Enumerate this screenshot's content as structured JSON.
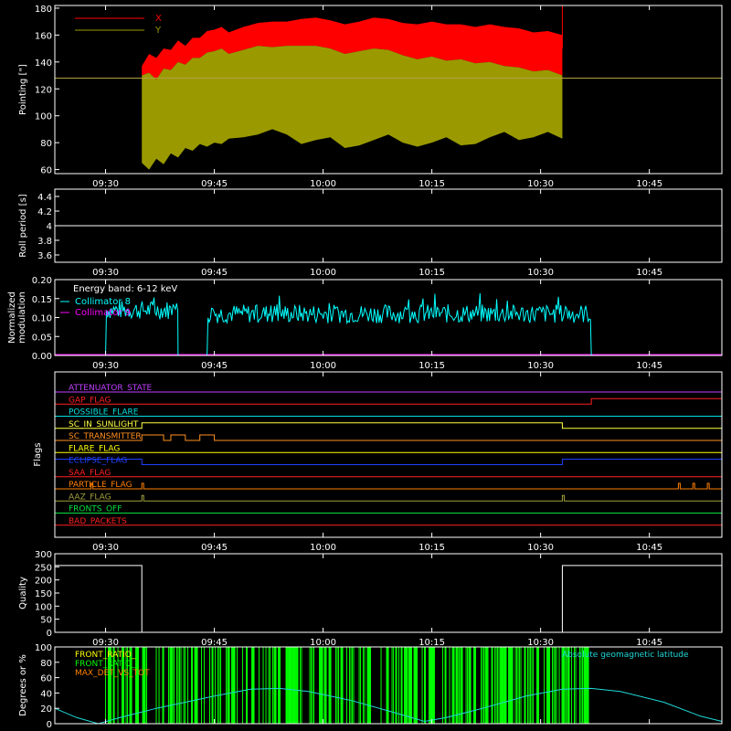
{
  "chart_data": [
    {
      "type": "line",
      "ylabel": "Pointing [\"]",
      "ylim": [
        57,
        182
      ],
      "yticks": [
        60,
        80,
        100,
        120,
        140,
        160,
        180
      ],
      "xticks": [
        "09:30",
        "09:45",
        "10:00",
        "10:15",
        "10:30",
        "10:45"
      ],
      "legend": [
        {
          "name": "X",
          "color": "#ff0000"
        },
        {
          "name": "Y",
          "color": "#9a9a00"
        }
      ],
      "reference_line": 128,
      "data_start": "09:35",
      "data_end": "10:33",
      "x_band_upper": [
        [
          0,
          137
        ],
        [
          1,
          146
        ],
        [
          2,
          143
        ],
        [
          3,
          150
        ],
        [
          4,
          149
        ],
        [
          5,
          156
        ],
        [
          6,
          152
        ],
        [
          7,
          158
        ],
        [
          8,
          158
        ],
        [
          9,
          163
        ],
        [
          10,
          164
        ],
        [
          11,
          166
        ],
        [
          12,
          162
        ],
        [
          14,
          166
        ],
        [
          16,
          169
        ],
        [
          18,
          170
        ],
        [
          20,
          170
        ],
        [
          22,
          172
        ],
        [
          24,
          173
        ],
        [
          26,
          171
        ],
        [
          28,
          168
        ],
        [
          30,
          170
        ],
        [
          32,
          173
        ],
        [
          34,
          172
        ],
        [
          36,
          169
        ],
        [
          38,
          168
        ],
        [
          40,
          170
        ],
        [
          42,
          168
        ],
        [
          44,
          168
        ],
        [
          46,
          166
        ],
        [
          48,
          168
        ],
        [
          50,
          166
        ],
        [
          52,
          165
        ],
        [
          54,
          162
        ],
        [
          56,
          163
        ],
        [
          58,
          160
        ]
      ],
      "y_band_upper": [
        [
          0,
          130
        ],
        [
          1,
          132
        ],
        [
          2,
          127
        ],
        [
          3,
          135
        ],
        [
          4,
          134
        ],
        [
          5,
          140
        ],
        [
          6,
          138
        ],
        [
          7,
          143
        ],
        [
          8,
          143
        ],
        [
          9,
          147
        ],
        [
          10,
          148
        ],
        [
          11,
          150
        ],
        [
          12,
          146
        ],
        [
          14,
          149
        ],
        [
          16,
          152
        ],
        [
          18,
          151
        ],
        [
          20,
          152
        ],
        [
          22,
          152
        ],
        [
          24,
          152
        ],
        [
          26,
          150
        ],
        [
          28,
          146
        ],
        [
          30,
          148
        ],
        [
          32,
          150
        ],
        [
          34,
          149
        ],
        [
          36,
          145
        ],
        [
          38,
          142
        ],
        [
          40,
          144
        ],
        [
          42,
          141
        ],
        [
          44,
          142
        ],
        [
          46,
          139
        ],
        [
          48,
          140
        ],
        [
          50,
          137
        ],
        [
          52,
          136
        ],
        [
          54,
          133
        ],
        [
          56,
          134
        ],
        [
          58,
          130
        ]
      ],
      "band_lower": [
        [
          0,
          65
        ],
        [
          1,
          60
        ],
        [
          2,
          68
        ],
        [
          3,
          64
        ],
        [
          4,
          72
        ],
        [
          5,
          69
        ],
        [
          6,
          76
        ],
        [
          7,
          74
        ],
        [
          8,
          79
        ],
        [
          9,
          77
        ],
        [
          10,
          80
        ],
        [
          11,
          79
        ],
        [
          12,
          83
        ],
        [
          14,
          84
        ],
        [
          16,
          86
        ],
        [
          18,
          90
        ],
        [
          20,
          86
        ],
        [
          22,
          79
        ],
        [
          24,
          82
        ],
        [
          26,
          84
        ],
        [
          28,
          76
        ],
        [
          30,
          78
        ],
        [
          32,
          82
        ],
        [
          34,
          86
        ],
        [
          36,
          80
        ],
        [
          38,
          77
        ],
        [
          40,
          80
        ],
        [
          42,
          84
        ],
        [
          44,
          78
        ],
        [
          46,
          79
        ],
        [
          48,
          84
        ],
        [
          50,
          88
        ],
        [
          52,
          82
        ],
        [
          54,
          84
        ],
        [
          56,
          88
        ],
        [
          58,
          83
        ]
      ],
      "x_spike_at": "10:33",
      "x_spike_range": [
        150,
        182
      ]
    },
    {
      "type": "line",
      "ylabel": "Roll period [s]",
      "ylim": [
        3.5,
        4.5
      ],
      "yticks": [
        3.6,
        3.8,
        4.0,
        4.2,
        4.4
      ],
      "xticks": [
        "09:30",
        "09:45",
        "10:00",
        "10:15",
        "10:30",
        "10:45"
      ],
      "series": [
        {
          "value": 4.0,
          "color": "#ffffff"
        }
      ]
    },
    {
      "type": "line",
      "ylabel": "Normalized\nmodulation",
      "ylim": [
        0,
        0.2
      ],
      "yticks": [
        0.0,
        0.05,
        0.1,
        0.15,
        0.2
      ],
      "ytick_labels": [
        "0.00",
        "0.05",
        "0.10",
        "0.15",
        "0.20"
      ],
      "xticks": [
        "09:30",
        "09:45",
        "10:00",
        "10:15",
        "10:30",
        "10:45"
      ],
      "annotation": "Energy band: 6-12 keV",
      "legend": [
        {
          "name": "Collimator 8",
          "color": "#00ffff"
        },
        {
          "name": "Collimator 9",
          "color": "#ff00ff"
        }
      ],
      "segments": [
        {
          "start": "09:30",
          "end": "09:40",
          "mean": 0.12
        },
        {
          "start": "09:44",
          "end": "10:37",
          "mean": 0.11
        }
      ]
    },
    {
      "type": "line",
      "ylabel": "Flags",
      "xticks": [
        "09:30",
        "09:45",
        "10:00",
        "10:15",
        "10:30",
        "10:45"
      ],
      "flags": [
        {
          "name": "ATTENUATOR_STATE",
          "color": "#c040ff",
          "on": []
        },
        {
          "name": "GAP_FLAG",
          "color": "#ff2020",
          "on": [
            [
              "10:37",
              "10:55"
            ]
          ]
        },
        {
          "name": "POSSIBLE_FLARE",
          "color": "#00e0e0",
          "on": []
        },
        {
          "name": "SC_IN_SUNLIGHT",
          "color": "#ffff40",
          "on": [
            [
              "09:35",
              "10:33"
            ]
          ]
        },
        {
          "name": "SC_TRANSMITTER",
          "color": "#ff9020",
          "on": [
            [
              "09:35",
              "09:38"
            ],
            [
              "09:39",
              "09:41"
            ],
            [
              "09:43",
              "09:45"
            ]
          ]
        },
        {
          "name": "FLARE_FLAG",
          "color": "#ffff00",
          "on": []
        },
        {
          "name": "ECLIPSE_FLAG",
          "color": "#2040ff",
          "on": [
            [
              "09:23",
              "09:35"
            ],
            [
              "10:33",
              "10:55"
            ]
          ]
        },
        {
          "name": "SAA_FLAG",
          "color": "#ff2020",
          "on": []
        },
        {
          "name": "PARTICLE_FLAG",
          "color": "#ff8000",
          "on": [
            [
              "09:28",
              "09:28"
            ],
            [
              "09:35",
              "09:35"
            ],
            [
              "10:49",
              "10:49"
            ],
            [
              "10:51",
              "10:51"
            ],
            [
              "10:53",
              "10:53"
            ]
          ]
        },
        {
          "name": "AAZ_FLAG",
          "color": "#a0a040",
          "on": [
            [
              "09:35",
              "09:35"
            ],
            [
              "10:33",
              "10:33"
            ]
          ]
        },
        {
          "name": "FRONTS_OFF",
          "color": "#00e040",
          "on": []
        },
        {
          "name": "BAD_PACKETS",
          "color": "#ff2020",
          "on": []
        }
      ]
    },
    {
      "type": "line",
      "ylabel": "Quality",
      "ylim": [
        0,
        300
      ],
      "yticks": [
        0,
        50,
        100,
        150,
        200,
        250,
        300
      ],
      "xticks": [
        "09:30",
        "09:45",
        "10:00",
        "10:15",
        "10:30",
        "10:45"
      ],
      "steps": [
        [
          "09:23",
          255
        ],
        [
          "09:35",
          0
        ],
        [
          "10:33",
          255
        ],
        [
          "10:55",
          255
        ]
      ]
    },
    {
      "type": "line",
      "ylabel": "Degrees or %",
      "ylim": [
        0,
        100
      ],
      "yticks": [
        0,
        20,
        40,
        60,
        80,
        100
      ],
      "xticks": [
        "09:30",
        "09:45",
        "10:00",
        "10:15",
        "10:30",
        "10:45"
      ],
      "legend": [
        {
          "name": "FRONT_RATIO_",
          "color": "#ffff00"
        },
        {
          "name": "FRONT_RATIO_",
          "color": "#00ff00"
        },
        {
          "name": "MAX_DET_VS_TOT",
          "color": "#ff8000"
        }
      ],
      "annotation": "Absolute geomagnetic latitude",
      "latitude_curve": [
        [
          "09:23",
          20
        ],
        [
          "09:26",
          8
        ],
        [
          "09:29",
          0
        ],
        [
          "09:32",
          8
        ],
        [
          "09:37",
          20
        ],
        [
          "09:45",
          36
        ],
        [
          "09:50",
          45
        ],
        [
          "09:54",
          46
        ],
        [
          "09:58",
          42
        ],
        [
          "10:04",
          30
        ],
        [
          "10:10",
          14
        ],
        [
          "10:14",
          3
        ],
        [
          "10:17",
          8
        ],
        [
          "10:22",
          20
        ],
        [
          "10:28",
          36
        ],
        [
          "10:33",
          45
        ],
        [
          "10:37",
          46
        ],
        [
          "10:41",
          42
        ],
        [
          "10:47",
          28
        ],
        [
          "10:52",
          10
        ],
        [
          "10:55",
          3
        ]
      ],
      "front_ratio_span": [
        "09:30",
        "10:37"
      ],
      "front_ratio_value": 100
    }
  ]
}
